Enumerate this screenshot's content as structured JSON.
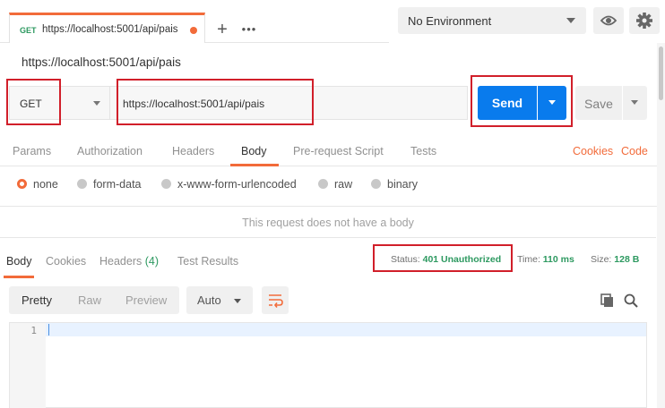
{
  "tab": {
    "method": "GET",
    "url": "https://localhost:5001/api/pais"
  },
  "tab_controls": {
    "new_tab": "+",
    "more": "•••"
  },
  "environment": {
    "selected": "No Environment"
  },
  "request": {
    "title": "https://localhost:5001/api/pais",
    "method": "GET",
    "url": "https://localhost:5001/api/pais",
    "send_label": "Send",
    "save_label": "Save"
  },
  "request_tabs": [
    "Params",
    "Authorization",
    "Headers",
    "Body",
    "Pre-request Script",
    "Tests"
  ],
  "request_links": {
    "cookies": "Cookies",
    "code": "Code"
  },
  "body_modes": [
    "none",
    "form-data",
    "x-www-form-urlencoded",
    "raw",
    "binary"
  ],
  "no_body_message": "This request does not have a body",
  "response_tabs": {
    "body": "Body",
    "cookies": "Cookies",
    "headers": "Headers",
    "headers_count": "(4)",
    "tests": "Test Results"
  },
  "response_status": {
    "status_label": "Status:",
    "status_value": "401 Unauthorized",
    "time_label": "Time:",
    "time_value": "110 ms",
    "size_label": "Size:",
    "size_value": "128 B"
  },
  "format_tabs": [
    "Pretty",
    "Raw",
    "Preview"
  ],
  "format_select": "Auto",
  "editor": {
    "line_number": "1"
  },
  "colors": {
    "accent": "#f26b3a",
    "primary": "#097bed",
    "success": "#2d9960",
    "highlight": "#d11f2a"
  }
}
